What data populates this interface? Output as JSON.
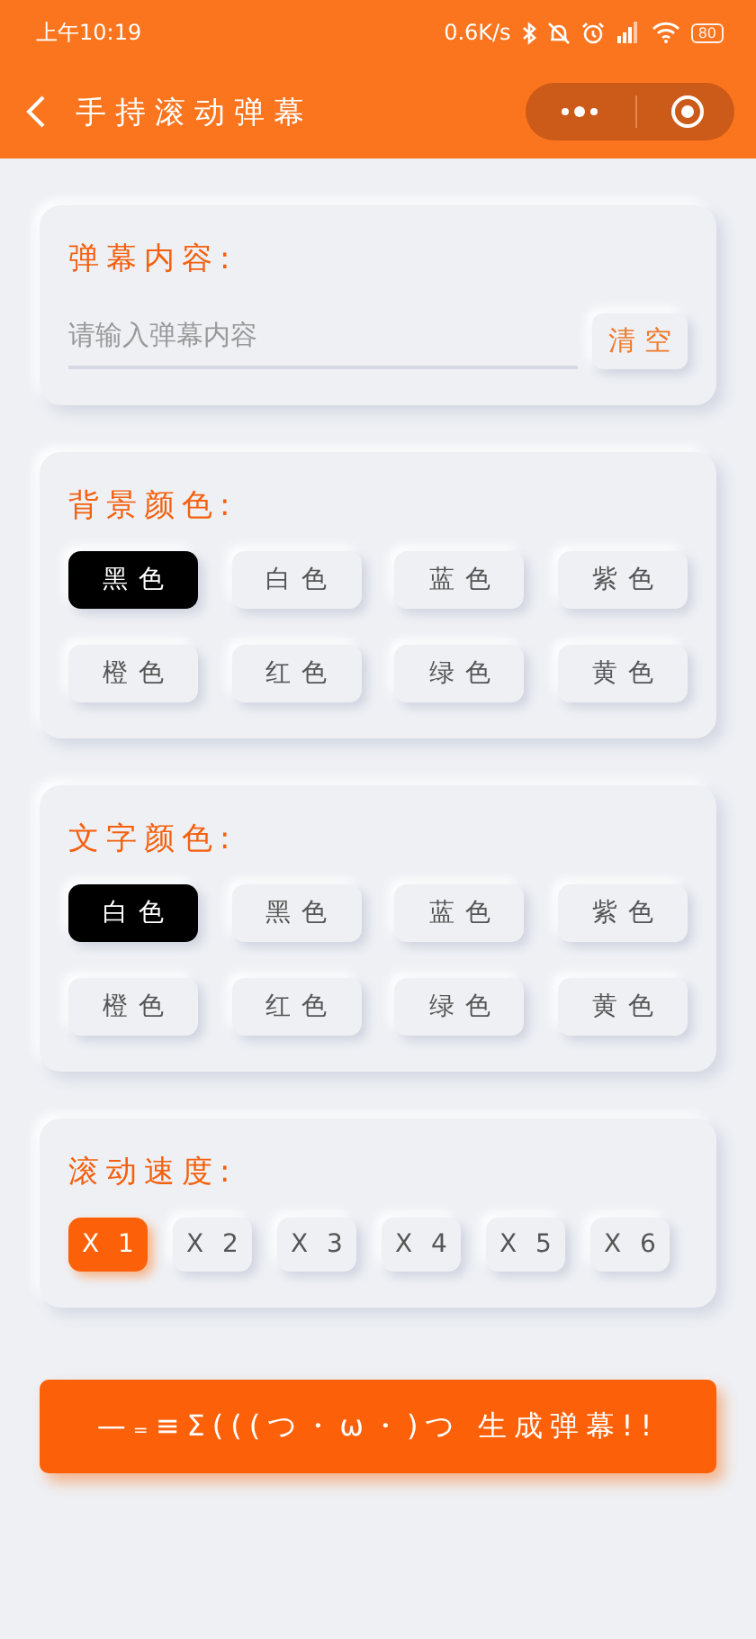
{
  "status_bar": {
    "time": "上午10:19",
    "net_speed": "0.6K/s",
    "battery": "80"
  },
  "nav": {
    "title": "手持滚动弹幕"
  },
  "sections": [
    {
      "kind": "input",
      "title": "弹幕内容:",
      "placeholder": "请输入弹幕内容",
      "button": "清空"
    },
    {
      "kind": "colors",
      "title": "背景颜色:",
      "options": [
        {
          "label": "黑色",
          "selected": true
        },
        {
          "label": "白色",
          "selected": false
        },
        {
          "label": "蓝色",
          "selected": false
        },
        {
          "label": "紫色",
          "selected": false
        },
        {
          "label": "橙色",
          "selected": false
        },
        {
          "label": "红色",
          "selected": false
        },
        {
          "label": "绿色",
          "selected": false
        },
        {
          "label": "黄色",
          "selected": false
        }
      ]
    },
    {
      "kind": "colors",
      "title": "文字颜色:",
      "options": [
        {
          "label": "白色",
          "selected": true
        },
        {
          "label": "黑色",
          "selected": false
        },
        {
          "label": "蓝色",
          "selected": false
        },
        {
          "label": "紫色",
          "selected": false
        },
        {
          "label": "橙色",
          "selected": false
        },
        {
          "label": "红色",
          "selected": false
        },
        {
          "label": "绿色",
          "selected": false
        },
        {
          "label": "黄色",
          "selected": false
        }
      ]
    },
    {
      "kind": "speeds",
      "title": "滚动速度:",
      "options": [
        {
          "label": "X 1",
          "selected": true
        },
        {
          "label": "X 2",
          "selected": false
        },
        {
          "label": "X 3",
          "selected": false
        },
        {
          "label": "X 4",
          "selected": false
        },
        {
          "label": "X 5",
          "selected": false
        },
        {
          "label": "X 6",
          "selected": false
        }
      ]
    }
  ],
  "generate_button": "—₌≡Σ(((つ・ω・)つ 生成弹幕!!"
}
